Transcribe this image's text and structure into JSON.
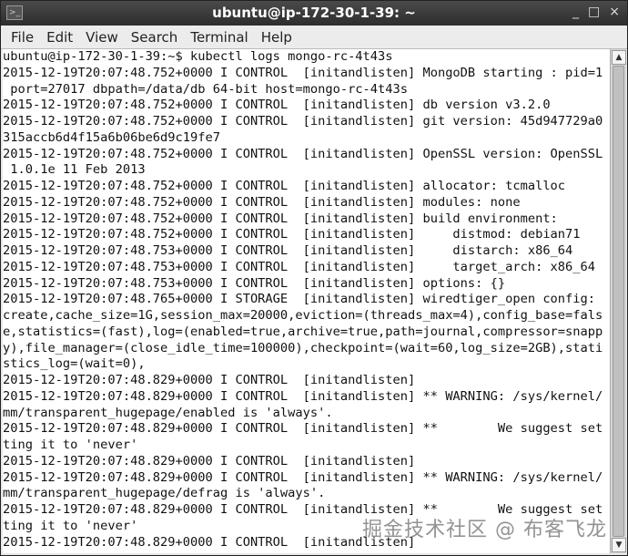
{
  "window": {
    "title": "ubuntu@ip-172-30-1-39: ~",
    "controls": [
      "_",
      "□",
      "×"
    ]
  },
  "menu": [
    "File",
    "Edit",
    "View",
    "Search",
    "Terminal",
    "Help"
  ],
  "terminal_lines": [
    "ubuntu@ip-172-30-1-39:~$ kubectl logs mongo-rc-4t43s",
    "2015-12-19T20:07:48.752+0000 I CONTROL  [initandlisten] MongoDB starting : pid=1",
    " port=27017 dbpath=/data/db 64-bit host=mongo-rc-4t43s",
    "2015-12-19T20:07:48.752+0000 I CONTROL  [initandlisten] db version v3.2.0",
    "2015-12-19T20:07:48.752+0000 I CONTROL  [initandlisten] git version: 45d947729a0",
    "315accb6d4f15a6b06be6d9c19fe7",
    "2015-12-19T20:07:48.752+0000 I CONTROL  [initandlisten] OpenSSL version: OpenSSL",
    " 1.0.1e 11 Feb 2013",
    "2015-12-19T20:07:48.752+0000 I CONTROL  [initandlisten] allocator: tcmalloc",
    "2015-12-19T20:07:48.752+0000 I CONTROL  [initandlisten] modules: none",
    "2015-12-19T20:07:48.752+0000 I CONTROL  [initandlisten] build environment:",
    "2015-12-19T20:07:48.752+0000 I CONTROL  [initandlisten]     distmod: debian71",
    "2015-12-19T20:07:48.753+0000 I CONTROL  [initandlisten]     distarch: x86_64",
    "2015-12-19T20:07:48.753+0000 I CONTROL  [initandlisten]     target_arch: x86_64",
    "2015-12-19T20:07:48.753+0000 I CONTROL  [initandlisten] options: {}",
    "2015-12-19T20:07:48.765+0000 I STORAGE  [initandlisten] wiredtiger_open config:",
    "create,cache_size=1G,session_max=20000,eviction=(threads_max=4),config_base=fals",
    "e,statistics=(fast),log=(enabled=true,archive=true,path=journal,compressor=snapp",
    "y),file_manager=(close_idle_time=100000),checkpoint=(wait=60,log_size=2GB),stati",
    "stics_log=(wait=0),",
    "2015-12-19T20:07:48.829+0000 I CONTROL  [initandlisten]",
    "2015-12-19T20:07:48.829+0000 I CONTROL  [initandlisten] ** WARNING: /sys/kernel/",
    "mm/transparent_hugepage/enabled is 'always'.",
    "2015-12-19T20:07:48.829+0000 I CONTROL  [initandlisten] **        We suggest set",
    "ting it to 'never'",
    "2015-12-19T20:07:48.829+0000 I CONTROL  [initandlisten]",
    "2015-12-19T20:07:48.829+0000 I CONTROL  [initandlisten] ** WARNING: /sys/kernel/",
    "mm/transparent_hugepage/defrag is 'always'.",
    "2015-12-19T20:07:48.829+0000 I CONTROL  [initandlisten] **        We suggest set",
    "ting it to 'never'",
    "2015-12-19T20:07:48.829+0000 I CONTROL  [initandlisten]"
  ],
  "watermark": "掘金技术社区 @ 布客飞龙"
}
